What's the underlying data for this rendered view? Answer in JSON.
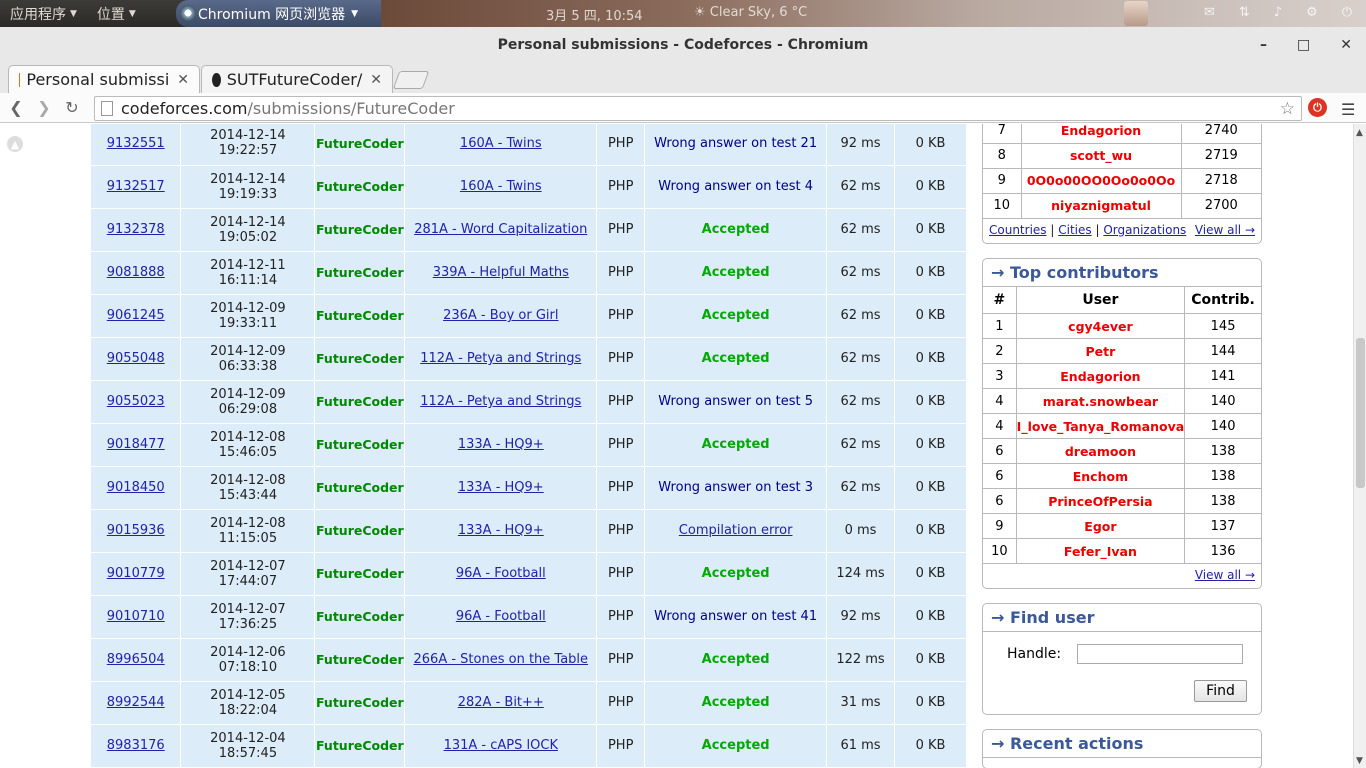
{
  "os": {
    "menu_apps": "应用程序",
    "menu_places": "位置",
    "app_name": "Chromium 网页浏览器",
    "clock": "3月 5 四, 10:54",
    "weather": "Clear Sky, 6 °C"
  },
  "window": {
    "title": "Personal submissions - Codeforces - Chromium"
  },
  "tabs": [
    {
      "label": "Personal submissi",
      "icon": "codeforces-icon"
    },
    {
      "label": "SUTFutureCoder/",
      "icon": "github-icon"
    }
  ],
  "omnibox": {
    "host": "codeforces.com",
    "path": "/submissions/FutureCoder"
  },
  "submissions": [
    {
      "id": "9132551",
      "date": "2014-12-14",
      "time": "19:22:57",
      "who": "FutureCoder",
      "problem": "160A - Twins",
      "lang": "PHP",
      "verdict": "Wrong answer on test 21",
      "vtype": "wa",
      "t": "92 ms",
      "m": "0 KB"
    },
    {
      "id": "9132517",
      "date": "2014-12-14",
      "time": "19:19:33",
      "who": "FutureCoder",
      "problem": "160A - Twins",
      "lang": "PHP",
      "verdict": "Wrong answer on test 4",
      "vtype": "wa",
      "t": "62 ms",
      "m": "0 KB"
    },
    {
      "id": "9132378",
      "date": "2014-12-14",
      "time": "19:05:02",
      "who": "FutureCoder",
      "problem": "281A - Word Capitalization",
      "lang": "PHP",
      "verdict": "Accepted",
      "vtype": "ok",
      "t": "62 ms",
      "m": "0 KB"
    },
    {
      "id": "9081888",
      "date": "2014-12-11",
      "time": "16:11:14",
      "who": "FutureCoder",
      "problem": "339A - Helpful Maths",
      "lang": "PHP",
      "verdict": "Accepted",
      "vtype": "ok",
      "t": "62 ms",
      "m": "0 KB"
    },
    {
      "id": "9061245",
      "date": "2014-12-09",
      "time": "19:33:11",
      "who": "FutureCoder",
      "problem": "236A - Boy or Girl",
      "lang": "PHP",
      "verdict": "Accepted",
      "vtype": "ok",
      "t": "62 ms",
      "m": "0 KB"
    },
    {
      "id": "9055048",
      "date": "2014-12-09",
      "time": "06:33:38",
      "who": "FutureCoder",
      "problem": "112A - Petya and Strings",
      "lang": "PHP",
      "verdict": "Accepted",
      "vtype": "ok",
      "t": "62 ms",
      "m": "0 KB"
    },
    {
      "id": "9055023",
      "date": "2014-12-09",
      "time": "06:29:08",
      "who": "FutureCoder",
      "problem": "112A - Petya and Strings",
      "lang": "PHP",
      "verdict": "Wrong answer on test 5",
      "vtype": "wa",
      "t": "62 ms",
      "m": "0 KB"
    },
    {
      "id": "9018477",
      "date": "2014-12-08",
      "time": "15:46:05",
      "who": "FutureCoder",
      "problem": "133A - HQ9+",
      "lang": "PHP",
      "verdict": "Accepted",
      "vtype": "ok",
      "t": "62 ms",
      "m": "0 KB"
    },
    {
      "id": "9018450",
      "date": "2014-12-08",
      "time": "15:43:44",
      "who": "FutureCoder",
      "problem": "133A - HQ9+",
      "lang": "PHP",
      "verdict": "Wrong answer on test 3",
      "vtype": "wa",
      "t": "62 ms",
      "m": "0 KB"
    },
    {
      "id": "9015936",
      "date": "2014-12-08",
      "time": "11:15:05",
      "who": "FutureCoder",
      "problem": "133A - HQ9+",
      "lang": "PHP",
      "verdict": "Compilation error",
      "vtype": "ce",
      "t": "0 ms",
      "m": "0 KB"
    },
    {
      "id": "9010779",
      "date": "2014-12-07",
      "time": "17:44:07",
      "who": "FutureCoder",
      "problem": "96A - Football",
      "lang": "PHP",
      "verdict": "Accepted",
      "vtype": "ok",
      "t": "124 ms",
      "m": "0 KB"
    },
    {
      "id": "9010710",
      "date": "2014-12-07",
      "time": "17:36:25",
      "who": "FutureCoder",
      "problem": "96A - Football",
      "lang": "PHP",
      "verdict": "Wrong answer on test 41",
      "vtype": "wa",
      "t": "92 ms",
      "m": "0 KB"
    },
    {
      "id": "8996504",
      "date": "2014-12-06",
      "time": "07:18:10",
      "who": "FutureCoder",
      "problem": "266A - Stones on the Table",
      "lang": "PHP",
      "verdict": "Accepted",
      "vtype": "ok",
      "t": "122 ms",
      "m": "0 KB"
    },
    {
      "id": "8992544",
      "date": "2014-12-05",
      "time": "18:22:04",
      "who": "FutureCoder",
      "problem": "282A - Bit++",
      "lang": "PHP",
      "verdict": "Accepted",
      "vtype": "ok",
      "t": "31 ms",
      "m": "0 KB"
    },
    {
      "id": "8983176",
      "date": "2014-12-04",
      "time": "18:57:45",
      "who": "FutureCoder",
      "problem": "131A - cAPS lOCK",
      "lang": "PHP",
      "verdict": "Accepted",
      "vtype": "ok",
      "t": "61 ms",
      "m": "0 KB"
    }
  ],
  "top_rated": {
    "rows": [
      {
        "rank": "7",
        "user": "Endagorion",
        "value": "2740"
      },
      {
        "rank": "8",
        "user": "scott_wu",
        "value": "2719"
      },
      {
        "rank": "9",
        "user": "0O0o00OO0Oo0o0Oo",
        "value": "2718"
      },
      {
        "rank": "10",
        "user": "niyaznigmatul",
        "value": "2700"
      }
    ],
    "links": [
      "Countries",
      "Cities",
      "Organizations"
    ],
    "view_all": "View all →"
  },
  "top_contributors": {
    "title": "→ Top contributors",
    "headers": [
      "#",
      "User",
      "Contrib."
    ],
    "rows": [
      {
        "rank": "1",
        "user": "cgy4ever",
        "value": "145"
      },
      {
        "rank": "2",
        "user": "Petr",
        "value": "144"
      },
      {
        "rank": "3",
        "user": "Endagorion",
        "value": "141"
      },
      {
        "rank": "4",
        "user": "marat.snowbear",
        "value": "140"
      },
      {
        "rank": "4",
        "user": "I_love_Tanya_Romanova",
        "value": "140"
      },
      {
        "rank": "6",
        "user": "dreamoon",
        "value": "138"
      },
      {
        "rank": "6",
        "user": "Enchom",
        "value": "138"
      },
      {
        "rank": "6",
        "user": "PrinceOfPersia",
        "value": "138"
      },
      {
        "rank": "9",
        "user": "Egor",
        "value": "137"
      },
      {
        "rank": "10",
        "user": "Fefer_Ivan",
        "value": "136"
      }
    ],
    "view_all": "View all →"
  },
  "find_user": {
    "title": "→ Find user",
    "label": "Handle:",
    "button": "Find"
  },
  "recent_actions": {
    "title": "→ Recent actions"
  }
}
